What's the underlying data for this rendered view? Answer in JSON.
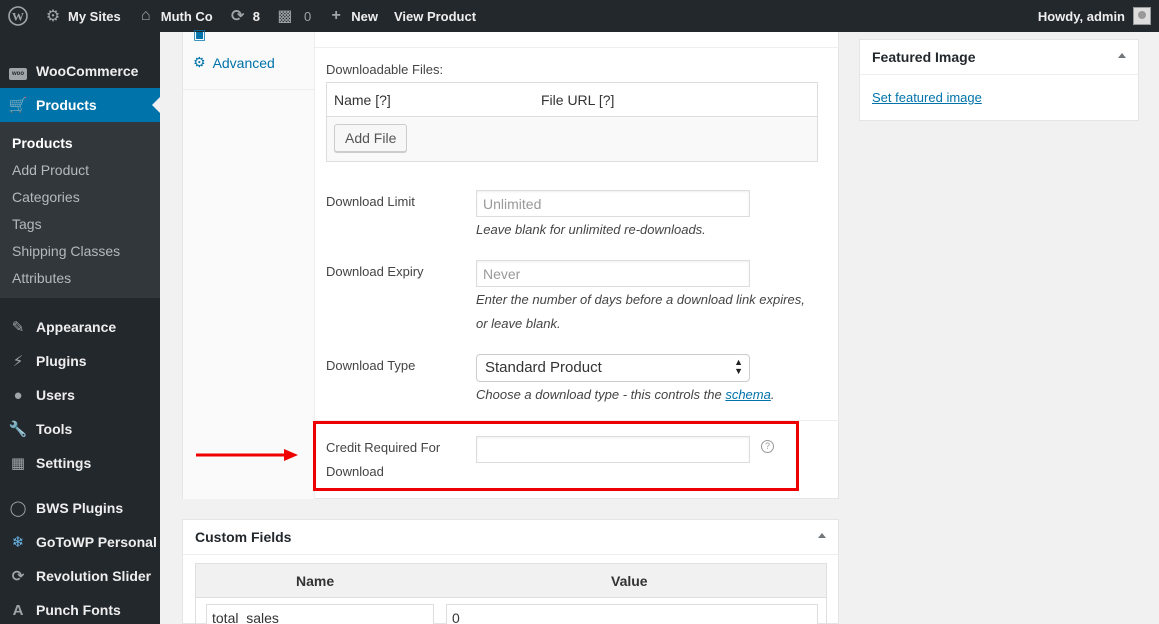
{
  "adminbar": {
    "my_sites": "My Sites",
    "site_name": "Muth Co",
    "updates_count": "8",
    "comments_count": "0",
    "new_label": "New",
    "view_product": "View Product",
    "howdy": "Howdy, admin"
  },
  "sidebar": {
    "woocommerce": "WooCommerce",
    "products": "Products",
    "submenu": [
      "Products",
      "Add Product",
      "Categories",
      "Tags",
      "Shipping Classes",
      "Attributes"
    ],
    "items": [
      "Appearance",
      "Plugins",
      "Users",
      "Tools",
      "Settings",
      "BWS Plugins",
      "GoToWP Personal",
      "Revolution Slider",
      "Punch Fonts"
    ]
  },
  "product_data": {
    "tab_advanced": "Advanced",
    "downloadable_files_label": "Downloadable Files:",
    "col_name": "Name [?]",
    "col_file_url": "File URL [?]",
    "add_file": "Add File",
    "download_limit_label": "Download Limit",
    "download_limit_placeholder": "Unlimited",
    "download_limit_desc": "Leave blank for unlimited re-downloads.",
    "download_expiry_label": "Download Expiry",
    "download_expiry_placeholder": "Never",
    "download_expiry_desc_1": "Enter the number of days before a download link expires,",
    "download_expiry_desc_2": "or leave blank.",
    "download_type_label": "Download Type",
    "download_type_value": "Standard Product",
    "download_type_desc": "Choose a download type - this controls the",
    "schema_link": "schema",
    "credit_label_1": "Credit Required For",
    "credit_label_2": "Download",
    "credit_value": "",
    "help_glyph": "?"
  },
  "featured_image": {
    "title": "Featured Image",
    "link": "Set featured image"
  },
  "custom_fields": {
    "title": "Custom Fields",
    "col_name": "Name",
    "col_value": "Value",
    "row_name": "total_sales",
    "row_value": "0"
  },
  "colors": {
    "adminbar_bg": "#23282d",
    "sidebar_bg": "#23282d",
    "submenu_bg": "#32373c",
    "active_blue": "#0073aa",
    "highlight_red": "#e00000"
  }
}
